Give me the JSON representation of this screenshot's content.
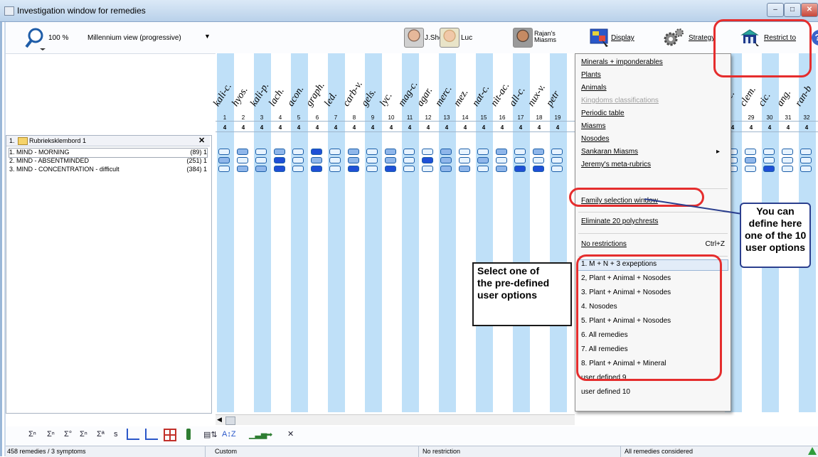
{
  "window": {
    "title": "Investigation window for remedies"
  },
  "toolbar": {
    "zoom_label": "100 %",
    "view_label": "Millennium view (progressive)",
    "sherr_label": "J.Sherr",
    "luc_label": "Luc",
    "rajan_label": "Rajan's\nMiasms",
    "display_label": "Display",
    "strategy_label": "Strategy",
    "restrict_label": "Restrict to"
  },
  "remedy_columns": [
    {
      "name": "kali-c.",
      "num": "1",
      "value": "4"
    },
    {
      "name": "hyos.",
      "num": "2",
      "value": "4"
    },
    {
      "name": "kali-p.",
      "num": "3",
      "value": "4"
    },
    {
      "name": "lach.",
      "num": "4",
      "value": "4"
    },
    {
      "name": "acon.",
      "num": "5",
      "value": "4"
    },
    {
      "name": "graph.",
      "num": "6",
      "value": "4"
    },
    {
      "name": "led.",
      "num": "7",
      "value": "4"
    },
    {
      "name": "carb-v.",
      "num": "8",
      "value": "4"
    },
    {
      "name": "gels.",
      "num": "9",
      "value": "4"
    },
    {
      "name": "lyc.",
      "num": "10",
      "value": "4"
    },
    {
      "name": "mag-c.",
      "num": "11",
      "value": "4"
    },
    {
      "name": "agar.",
      "num": "12",
      "value": "4"
    },
    {
      "name": "merc.",
      "num": "13",
      "value": "4"
    },
    {
      "name": "mez.",
      "num": "14",
      "value": "4"
    },
    {
      "name": "nat-c.",
      "num": "15",
      "value": "4"
    },
    {
      "name": "nit-ac.",
      "num": "16",
      "value": "4"
    },
    {
      "name": "all-c.",
      "num": "17",
      "value": "4"
    },
    {
      "name": "nux-v.",
      "num": "18",
      "value": "4"
    },
    {
      "name": "petr",
      "num": "19",
      "value": "4"
    }
  ],
  "remedy_columns_right": [
    {
      "name": "occ.",
      "num": "",
      "value": "4"
    },
    {
      "name": "clem.",
      "num": "29",
      "value": "4"
    },
    {
      "name": "cic.",
      "num": "30",
      "value": "4"
    },
    {
      "name": "ang.",
      "num": "31",
      "value": "4"
    },
    {
      "name": "ran-b",
      "num": "32",
      "value": "4"
    }
  ],
  "clipboard": {
    "label": "1.",
    "name": "Rubrieksklembord 1"
  },
  "symptoms": [
    {
      "label": "1. MIND - MORNING",
      "count": "(89) 1"
    },
    {
      "label": "2. MIND - ABSENTMINDED",
      "count": "(251) 1"
    },
    {
      "label": "3. MIND - CONCENTRATION - difficult",
      "count": "(384) 1"
    }
  ],
  "menu": {
    "items": [
      {
        "label": "Minerals + imponderables",
        "disabled": false
      },
      {
        "label": "Plants",
        "disabled": false
      },
      {
        "label": "Animals",
        "disabled": false
      },
      {
        "label": "Kingdoms classifications",
        "disabled": true
      },
      {
        "label": "Periodic table",
        "disabled": false
      },
      {
        "label": "Miasms",
        "disabled": false
      },
      {
        "label": "Nosodes",
        "disabled": false
      },
      {
        "label": "Sankaran Miasms",
        "disabled": false
      },
      {
        "label": "Jeremy's meta-rubrics",
        "disabled": false
      }
    ],
    "family_selection": "Family selection window",
    "eliminate": "Eliminate 20 polychrests",
    "no_restrictions": "No restrictions",
    "no_restrictions_shortcut": "Ctrl+Z",
    "user_options": [
      "1. M + N + 3 expeptions",
      "2, Plant + Animal + Nosodes",
      "3. Plant + Animal + Nosodes",
      "4. Nosodes",
      "5. Plant + Animal + Nosodes",
      "6. All remedies",
      "7. All remedies",
      "8. Plant + Animal + Mineral",
      "user defined 9",
      "user defined 10"
    ]
  },
  "callouts": {
    "select": "Select one of\nthe pre-defined\nuser options",
    "define": "You can\ndefine here\none of the 10\nuser options"
  },
  "statusbar": {
    "remedies": "458 remedies / 3 symptoms",
    "custom": "Custom",
    "restriction": "No restriction",
    "considered": "All remedies considered"
  },
  "colors": {
    "stripe": "#bfe0f8",
    "cell_border": "#1b5ea8",
    "annotation": "#e52d2d"
  }
}
